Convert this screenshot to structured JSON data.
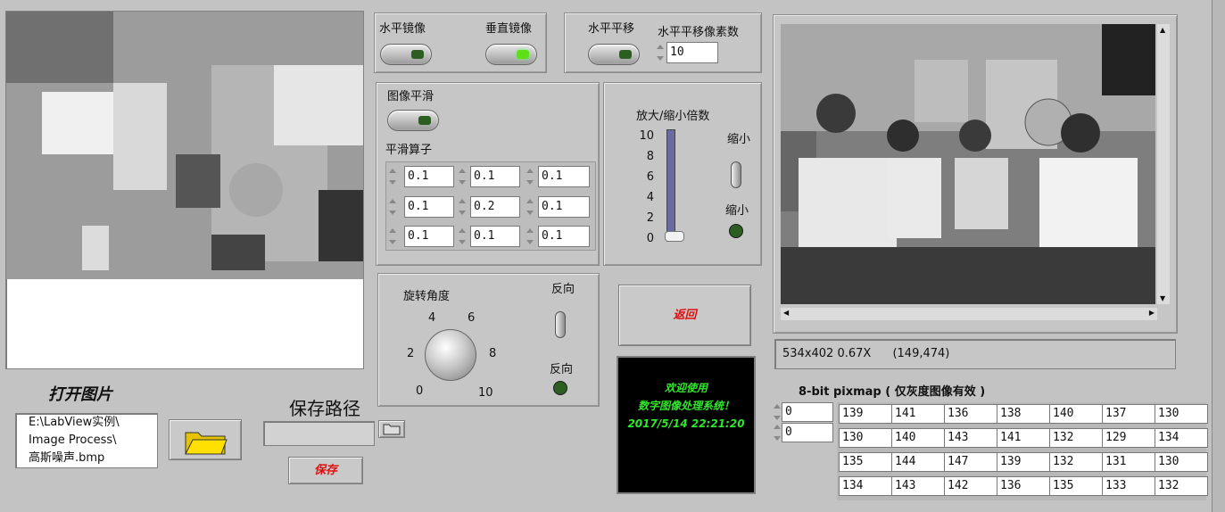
{
  "mirror": {
    "horizontal_label": "水平镜像",
    "vertical_label": "垂直镜像"
  },
  "shift": {
    "label": "水平平移",
    "pixels_label": "水平平移像素数",
    "pixels_value": "10"
  },
  "smooth": {
    "label": "图像平滑",
    "operator_label": "平滑算子",
    "matrix": [
      [
        "0.1",
        "0.1",
        "0.1"
      ],
      [
        "0.1",
        "0.2",
        "0.1"
      ],
      [
        "0.1",
        "0.1",
        "0.1"
      ]
    ]
  },
  "zoom": {
    "title": "放大/缩小倍数",
    "ticks": [
      "10",
      "8",
      "6",
      "4",
      "2",
      "0"
    ],
    "switch_label": "缩小",
    "led_label": "缩小",
    "level": 0
  },
  "rotate": {
    "label": "旋转角度",
    "ticks": [
      "4",
      "6",
      "2",
      "8",
      "0",
      "10"
    ],
    "switch_label": "反向",
    "led_label": "反向"
  },
  "return_button": "返回",
  "welcome": {
    "line1": "欢迎使用",
    "line2": "数字图像处理系统！",
    "line3": "2017/5/14 22:21:20"
  },
  "open": {
    "title": "打开图片",
    "path_lines": [
      "E:\\LabView实例\\",
      "Image Process\\",
      "高斯噪声.bmp"
    ]
  },
  "save": {
    "path_title": "保存路径",
    "path_value": "",
    "button": "保存"
  },
  "image_info": {
    "size": "534x402 0.67X",
    "coords": "(149,474)"
  },
  "pixmap": {
    "title": "8-bit pixmap ( 仅灰度图像有效 )",
    "row_index": "0",
    "col_index": "0",
    "rows": [
      [
        "139",
        "141",
        "136",
        "138",
        "140",
        "137",
        "130"
      ],
      [
        "130",
        "140",
        "143",
        "141",
        "132",
        "129",
        "134"
      ],
      [
        "135",
        "144",
        "147",
        "139",
        "132",
        "131",
        "130"
      ],
      [
        "134",
        "143",
        "142",
        "136",
        "135",
        "133",
        "132"
      ]
    ]
  },
  "colors": {
    "led_on": "#5fe014",
    "led_off": "#2c5e22",
    "welcome_text": "#31e62c",
    "return_text": "#e01010"
  }
}
